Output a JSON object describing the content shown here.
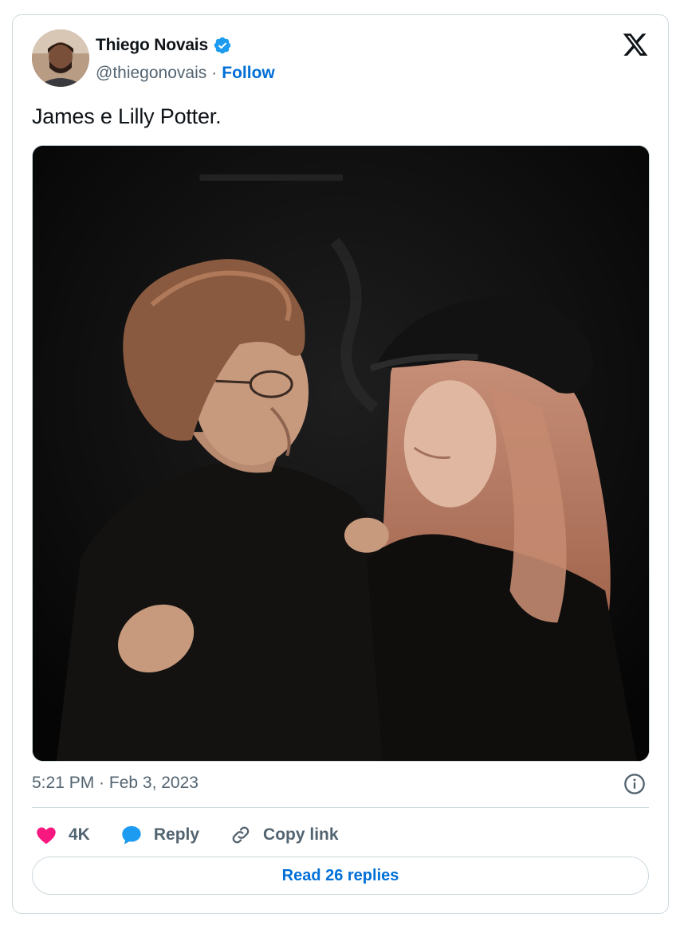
{
  "author": {
    "name": "Thiego Novais",
    "handle": "@thiegonovais",
    "separator": "·",
    "follow_label": "Follow",
    "verified": true
  },
  "tweet": {
    "text": "James e Lilly Potter.",
    "timestamp": "5:21 PM · Feb 3, 2023"
  },
  "actions": {
    "like_count": "4K",
    "reply_label": "Reply",
    "copy_label": "Copy link"
  },
  "read_replies_label": "Read 26 replies",
  "icons": {
    "like": "heart-icon",
    "reply": "speech-bubble-icon",
    "copy": "link-icon",
    "info": "info-icon",
    "brand": "x-logo-icon",
    "verified": "verified-badge-icon"
  },
  "colors": {
    "accent": "#006fd6",
    "like": "#f91880",
    "reply": "#1d9bf0",
    "muted": "#536471",
    "border": "#cfd9de"
  }
}
